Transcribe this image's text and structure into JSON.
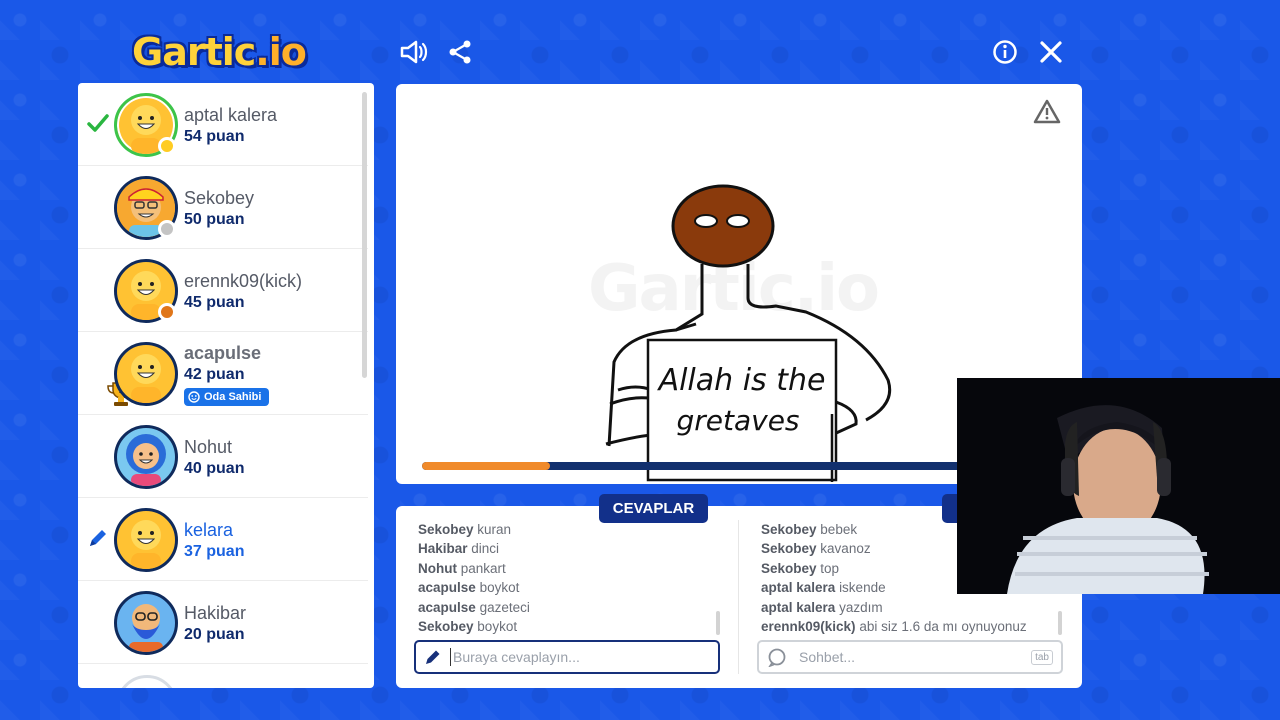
{
  "app": {
    "logo_main": "Gartic",
    "logo_suffix": ".io"
  },
  "header": {
    "icons": [
      "speaker-icon",
      "share-icon",
      "info-icon",
      "close-icon"
    ]
  },
  "players": [
    {
      "name": "aptal kalera",
      "score": "54 puan",
      "status_color": "#ffcc22",
      "marker": "check"
    },
    {
      "name": "Sekobey",
      "score": "50 puan",
      "status_color": "#c4c4c4"
    },
    {
      "name": "erennk09(kick)",
      "score": "45 puan",
      "status_color": "#e0761a"
    },
    {
      "name": "acapulse",
      "score": "42 puan",
      "badge": "Oda Sahibi",
      "marker": "trophy"
    },
    {
      "name": "Nohut",
      "score": "40 puan"
    },
    {
      "name": "kelara",
      "score": "37 puan",
      "marker": "pencil"
    },
    {
      "name": "Hakibar",
      "score": "20 puan"
    }
  ],
  "canvas": {
    "watermark": "Gartic.io",
    "sign_line1": "Allah is the",
    "sign_line2": "gretaves",
    "timer_progress": 0.2
  },
  "answers": {
    "title": "CEVAPLAR",
    "messages": [
      {
        "user": "Sekobey",
        "text": "kuran"
      },
      {
        "user": "Hakibar",
        "text": "dinci"
      },
      {
        "user": "Nohut",
        "text": "pankart"
      },
      {
        "user": "acapulse",
        "text": "boykot"
      },
      {
        "user": "acapulse",
        "text": "gazeteci"
      },
      {
        "user": "Sekobey",
        "text": "boykot"
      }
    ],
    "placeholder": "Buraya cevaplayın..."
  },
  "chat": {
    "messages": [
      {
        "user": "Sekobey",
        "text": "bebek"
      },
      {
        "user": "Sekobey",
        "text": "kavanoz"
      },
      {
        "user": "Sekobey",
        "text": "top"
      },
      {
        "user": "aptal kalera",
        "text": "iskende"
      },
      {
        "user": "aptal kalera",
        "text": "yazdım"
      },
      {
        "user": "erennk09(kick)",
        "text": "abi siz 1.6 da mı oynuyonuz"
      }
    ],
    "placeholder": "Sohbet...",
    "tab_hint": "tab"
  },
  "colors": {
    "background": "#1a58e8",
    "navy": "#12308a",
    "accent_blue": "#1a62e0",
    "timer": "#f08a2a",
    "correct_green": "#3cc44a"
  }
}
